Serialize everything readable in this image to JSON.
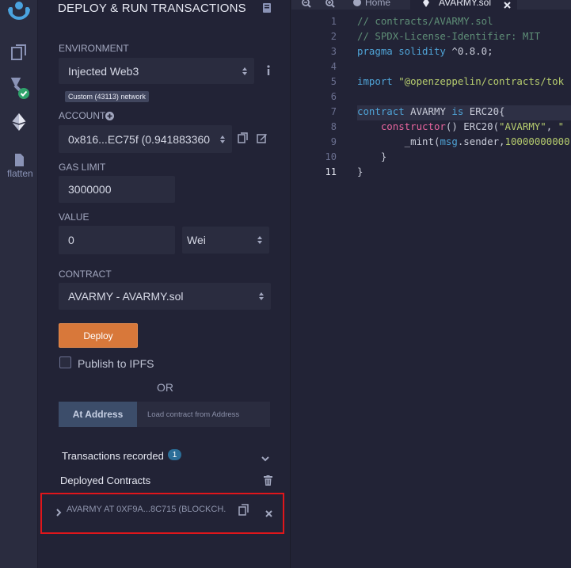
{
  "panel": {
    "title": "DEPLOY & RUN TRANSACTIONS",
    "environment_label": "ENVIRONMENT",
    "environment_value": "Injected Web3",
    "network_badge": "Custom (43113) network",
    "account_label": "ACCOUNT",
    "account_value": "0x816...EC75f (0.941883360",
    "gas_limit_label": "GAS LIMIT",
    "gas_limit_value": "3000000",
    "value_label": "VALUE",
    "value_value": "0",
    "value_unit": "Wei",
    "contract_label": "CONTRACT",
    "contract_value": "AVARMY - AVARMY.sol",
    "deploy_label": "Deploy",
    "publish_label": "Publish to IPFS",
    "or_label": "OR",
    "at_address_label": "At Address",
    "at_address_placeholder": "Load contract from Address",
    "transactions_label": "Transactions recorded",
    "transactions_count": "1",
    "deployed_label": "Deployed Contracts",
    "instance_label": "AVARMY AT 0XF9A...8C715 (BLOCKCH."
  },
  "iconbar": {
    "flatten_label": "flatten"
  },
  "editor": {
    "tabs": [
      {
        "label": "Home"
      },
      {
        "label": "AVARMY.sol"
      }
    ],
    "line_numbers": [
      "1",
      "2",
      "3",
      "4",
      "5",
      "6",
      "7",
      "8",
      "9",
      "10",
      "11"
    ],
    "current_line": "11",
    "lines": [
      {
        "parts": [
          {
            "t": "// contracts/AVARMY.sol",
            "c": "c-comment"
          }
        ]
      },
      {
        "parts": [
          {
            "t": "// SPDX-License-Identifier: MIT",
            "c": "c-comment"
          }
        ]
      },
      {
        "parts": [
          {
            "t": "pragma solidity ",
            "c": "c-kw"
          },
          {
            "t": "^0.8.0;",
            "c": "c-plain"
          }
        ]
      },
      {
        "parts": []
      },
      {
        "parts": [
          {
            "t": "import ",
            "c": "c-kw"
          },
          {
            "t": "\"@openzeppelin/contracts/tok",
            "c": "c-str"
          }
        ]
      },
      {
        "parts": []
      },
      {
        "parts": [
          {
            "t": "contract ",
            "c": "c-kw"
          },
          {
            "t": "AVARMY ",
            "c": "c-plain"
          },
          {
            "t": "is ",
            "c": "c-kw"
          },
          {
            "t": "ERC20{",
            "c": "c-plain"
          }
        ]
      },
      {
        "parts": [
          {
            "t": "    constructor",
            "c": "c-fn"
          },
          {
            "t": "() ERC20(",
            "c": "c-plain"
          },
          {
            "t": "\"AVARMY\"",
            "c": "c-str"
          },
          {
            "t": ", ",
            "c": "c-plain"
          },
          {
            "t": "\"",
            "c": "c-str"
          }
        ]
      },
      {
        "parts": [
          {
            "t": "        _mint(",
            "c": "c-plain"
          },
          {
            "t": "msg",
            "c": "c-kw"
          },
          {
            "t": ".sender,",
            "c": "c-plain"
          },
          {
            "t": "10000000000",
            "c": "c-num"
          }
        ]
      },
      {
        "parts": [
          {
            "t": "    }",
            "c": "c-plain"
          }
        ]
      },
      {
        "parts": [
          {
            "t": "}",
            "c": "c-plain"
          }
        ]
      }
    ]
  },
  "colors": {
    "deploy_button": "#d8783a",
    "highlight_box": "#e0161b",
    "badge": "#2b6e98"
  }
}
